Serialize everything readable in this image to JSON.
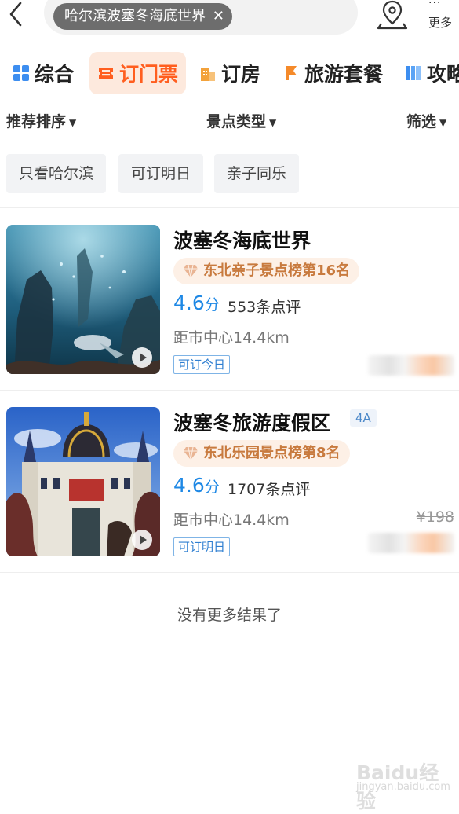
{
  "header": {
    "search_chip": "哈尔滨波塞冬海底世界",
    "clear_symbol": "✕",
    "more_dots": "···",
    "more_label": "更多"
  },
  "tabs": [
    {
      "label": "综合",
      "icon": "grid-icon",
      "active": false
    },
    {
      "label": "订门票",
      "icon": "ticket-icon",
      "active": true
    },
    {
      "label": "订房",
      "icon": "building-icon",
      "active": false
    },
    {
      "label": "旅游套餐",
      "icon": "flag-icon",
      "active": false
    },
    {
      "label": "攻略",
      "icon": "book-icon",
      "active": false
    }
  ],
  "filters": {
    "sort": "推荐排序",
    "type": "景点类型",
    "screen": "筛选",
    "caret": "▼"
  },
  "quick_tags": [
    "只看哈尔滨",
    "可订明日",
    "亲子同乐"
  ],
  "results": [
    {
      "title": "波塞冬海底世界",
      "level": "",
      "rank": "东北亲子景点榜第16名",
      "score": "4.6",
      "score_unit": "分",
      "reviews": "553条点评",
      "distance": "距市中心14.4km",
      "availability": "可订今日",
      "old_price": ""
    },
    {
      "title": "波塞冬旅游度假区",
      "level": "4A",
      "rank": "东北乐园景点榜第8名",
      "score": "4.6",
      "score_unit": "分",
      "reviews": "1707条点评",
      "distance": "距市中心14.4km",
      "availability": "可订明日",
      "old_price": "¥198"
    }
  ],
  "no_more_text": "没有更多结果了",
  "watermark": {
    "main": "Baidu经验",
    "sub": "jingyan.baidu.com"
  },
  "colors": {
    "accent": "#ff5e1f",
    "score_blue": "#1e88e5",
    "rank_text": "#c87a3e"
  }
}
